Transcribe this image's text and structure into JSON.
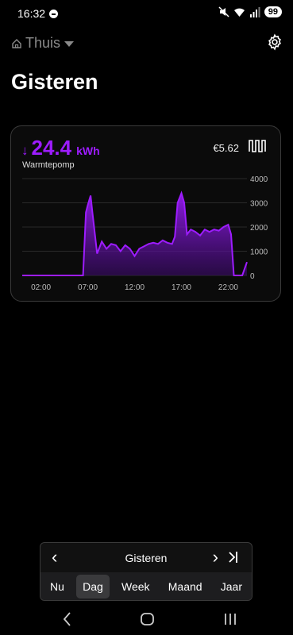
{
  "status": {
    "time": "16:32",
    "battery": "99"
  },
  "header": {
    "location": "Thuis",
    "title": "Gisteren"
  },
  "card": {
    "energy_value": "24.4",
    "energy_unit": "kWh",
    "device": "Warmtepomp",
    "cost": "€5.62"
  },
  "chart_data": {
    "type": "area",
    "series": [
      {
        "x": [
          0,
          1,
          2,
          3,
          4,
          5,
          6,
          6.5,
          6.8,
          7,
          7.3,
          7.5,
          8,
          8.5,
          9,
          9.5,
          10,
          10.5,
          11,
          11.5,
          12,
          12.5,
          13,
          13.5,
          14,
          14.5,
          15,
          15.5,
          16,
          16.3,
          16.6,
          17,
          17.3,
          17.6,
          18,
          18.5,
          19,
          19.5,
          20,
          20.5,
          21,
          21.5,
          22,
          22.3,
          22.6,
          23,
          23.5,
          24
        ],
        "values": [
          0,
          0,
          0,
          0,
          0,
          0,
          0,
          0,
          2600,
          2900,
          3300,
          2600,
          900,
          1400,
          1100,
          1300,
          1250,
          1000,
          1250,
          1100,
          800,
          1100,
          1200,
          1300,
          1350,
          1300,
          1450,
          1350,
          1300,
          1600,
          3000,
          3400,
          3000,
          1700,
          1900,
          1800,
          1650,
          1900,
          1800,
          1900,
          1850,
          2000,
          2100,
          1700,
          0,
          0,
          0,
          550
        ]
      }
    ],
    "x_ticks": [
      "02:00",
      "07:00",
      "12:00",
      "17:00",
      "22:00"
    ],
    "y_ticks": [
      "4000",
      "3000",
      "2000",
      "1000",
      "0"
    ],
    "ylim": [
      0,
      4000
    ],
    "color": "#9d1cff"
  },
  "nav": {
    "period_label": "Gisteren",
    "tabs": [
      "Nu",
      "Dag",
      "Week",
      "Maand",
      "Jaar"
    ]
  }
}
